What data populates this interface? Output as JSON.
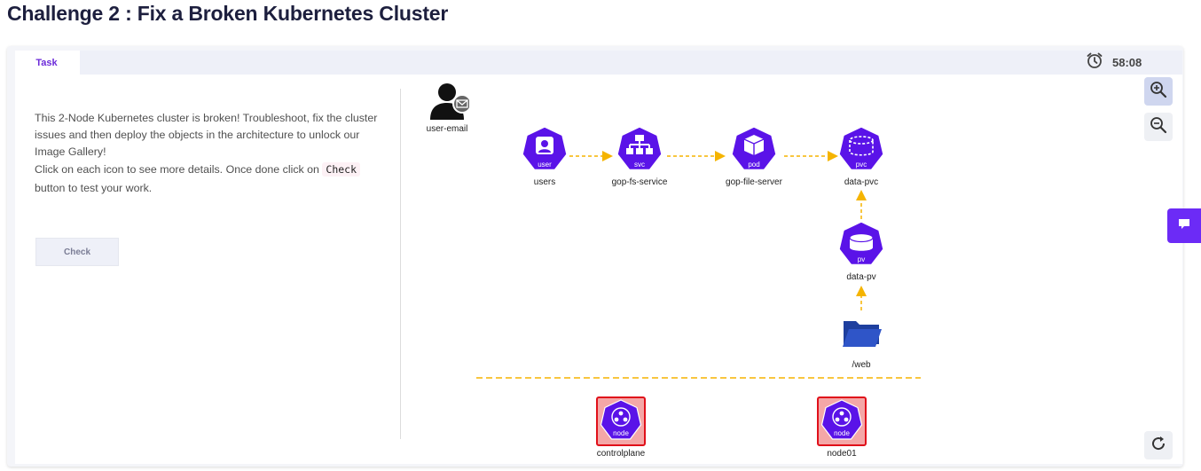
{
  "page": {
    "title": "Challenge 2 : Fix a Broken Kubernetes Cluster"
  },
  "tabs": [
    {
      "label": "Task",
      "active": true
    }
  ],
  "timer": {
    "icon": "alarm-clock-icon",
    "value": "58:08"
  },
  "task": {
    "line1": "This 2-Node Kubernetes cluster is broken! Troubleshoot, fix the cluster issues and then deploy the objects in the architecture to unlock our Image Gallery!",
    "line2_before": "Click on each icon to see more details. Once done click on ",
    "line2_code": "Check",
    "line2_after": " button to test your work.",
    "check_button": "Check"
  },
  "diagram": {
    "user_email": {
      "label": "user-email",
      "icon": "user-email-icon"
    },
    "users": {
      "label": "users",
      "type": "user"
    },
    "service": {
      "label": "gop-fs-service",
      "type": "svc"
    },
    "pod": {
      "label": "gop-file-server",
      "type": "pod"
    },
    "pvc": {
      "label": "data-pvc",
      "type": "pvc"
    },
    "pv": {
      "label": "data-pv",
      "type": "pv"
    },
    "folder": {
      "label": "/web",
      "icon": "folder-icon"
    },
    "controlplane": {
      "label": "controlplane",
      "type": "node"
    },
    "node01": {
      "label": "node01",
      "type": "node"
    }
  },
  "controls": {
    "zoom_in": "zoom-in-icon",
    "zoom_out": "zoom-out-icon",
    "refresh": "refresh-icon",
    "chat": "chat-icon"
  },
  "colors": {
    "accent": "#6c2bd9",
    "k8s_purple": "#5a13e8",
    "arrow": "#f5b400",
    "node_border": "#e0101a",
    "node_bg": "#f4a7a7",
    "folder": "#2f55c8",
    "title": "#1d1f3e"
  }
}
